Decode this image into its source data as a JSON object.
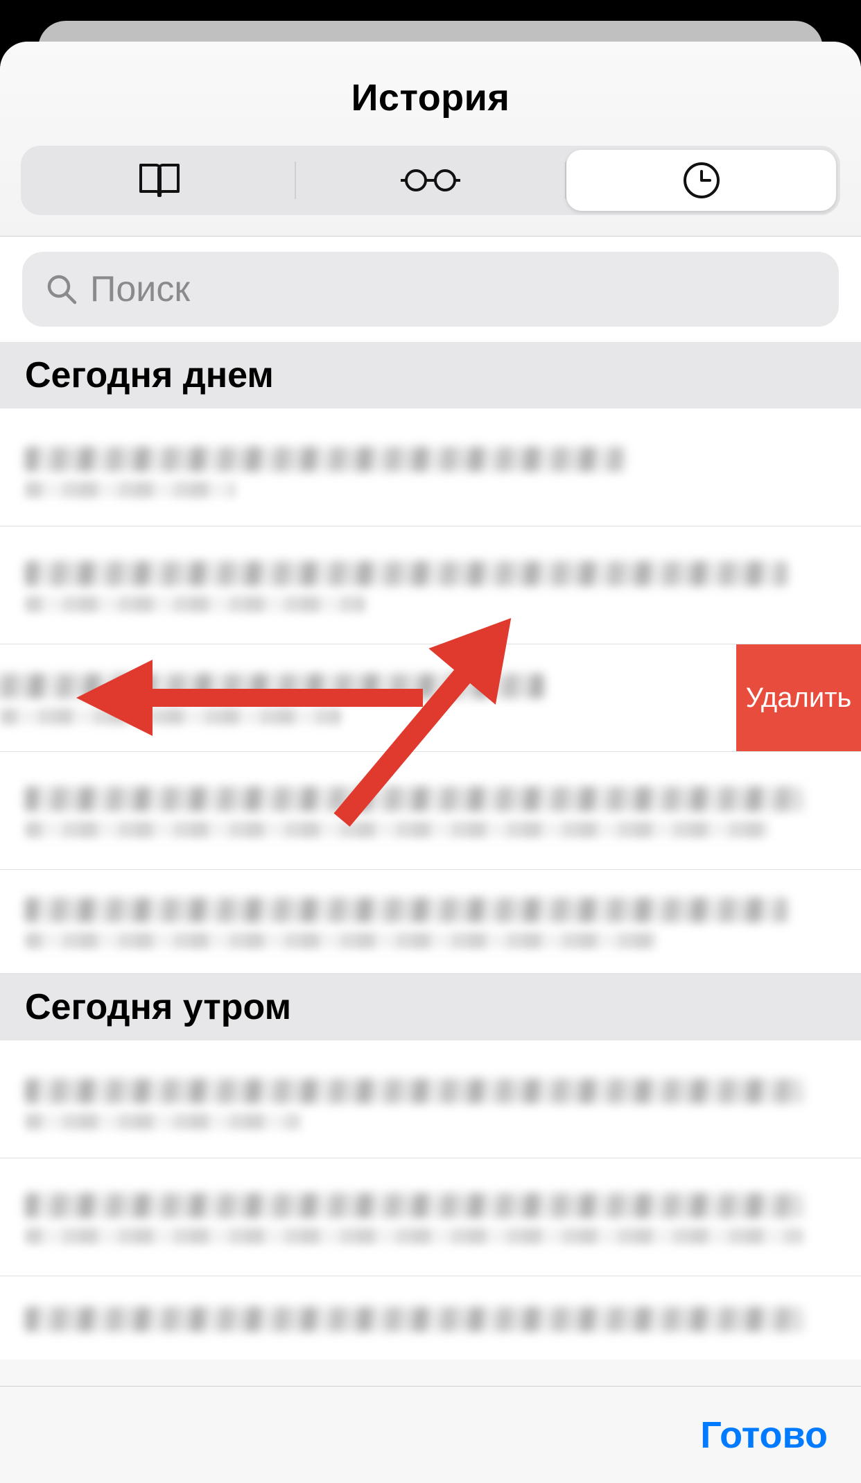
{
  "header": {
    "title": "История"
  },
  "search": {
    "placeholder": "Поиск"
  },
  "sections": {
    "afternoon": "Сегодня днем",
    "morning": "Сегодня утром"
  },
  "swipe": {
    "delete_label": "Удалить"
  },
  "footer": {
    "done_label": "Готово"
  },
  "colors": {
    "accent": "#007aff",
    "delete": "#e74c3c",
    "annotation": "#e0392d"
  }
}
